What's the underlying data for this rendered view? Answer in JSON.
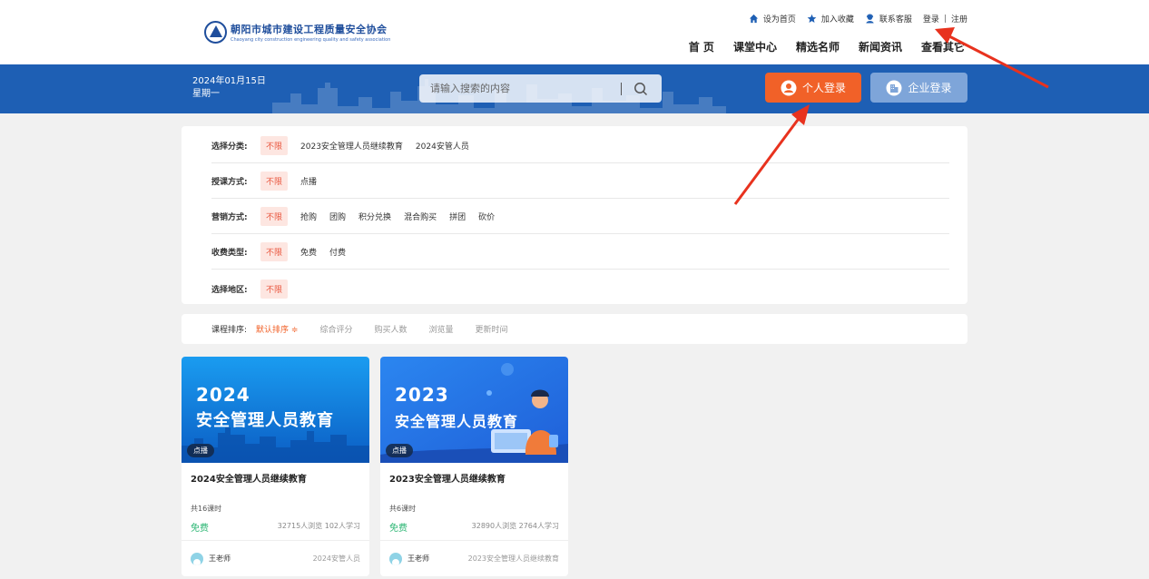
{
  "header": {
    "logo_cn": "朝阳市城市建设工程质量安全协会",
    "logo_en": "Chaoyang city construction engineering quality and safety association",
    "toplinks": {
      "home": "设为首页",
      "favorite": "加入收藏",
      "service": "联系客服",
      "login": "登录",
      "sep": "|",
      "register": "注册"
    },
    "nav": [
      "首 页",
      "课堂中心",
      "精选名师",
      "新闻资讯",
      "查看其它"
    ]
  },
  "banner": {
    "date": "2024年01月15日",
    "weekday": "星期一",
    "search_placeholder": "请输入搜索的内容",
    "personal_login": "个人登录",
    "enterprise_login": "企业登录"
  },
  "filters": [
    {
      "label": "选择分类:",
      "options": [
        "不限",
        "2023安全管理人员继续教育",
        "2024安管人员"
      ]
    },
    {
      "label": "授课方式:",
      "options": [
        "不限",
        "点播"
      ]
    },
    {
      "label": "营销方式:",
      "options": [
        "不限",
        "抢购",
        "团购",
        "积分兑换",
        "混合购买",
        "拼团",
        "砍价"
      ]
    },
    {
      "label": "收费类型:",
      "options": [
        "不限",
        "免费",
        "付费"
      ]
    },
    {
      "label": "选择地区:",
      "options": [
        "不限"
      ]
    }
  ],
  "sort": {
    "label": "课程排序:",
    "options": [
      "默认排序 ≑",
      "综合评分",
      "购买人数",
      "浏览量",
      "更新时间"
    ]
  },
  "courses": [
    {
      "thumb_year": "2024",
      "thumb_title": "安全管理人员教育",
      "badge": "点播",
      "title": "2024安全管理人员继续教育",
      "hours": "共16课时",
      "price": "免费",
      "stats": "32715人浏览   102人学习",
      "teacher": "王老师",
      "tag": "2024安管人员"
    },
    {
      "thumb_year": "2023",
      "thumb_title": "安全管理人员教育",
      "badge": "点播",
      "title": "2023安全管理人员继续教育",
      "hours": "共6课时",
      "price": "免费",
      "stats": "32890人浏览   2764人学习",
      "teacher": "王老师",
      "tag": "2023安全管理人员继续教育"
    }
  ],
  "colors": {
    "banner": "#1e5fb4",
    "accent": "#f16128",
    "free": "#2bb673",
    "arrow": "#e8321e"
  }
}
